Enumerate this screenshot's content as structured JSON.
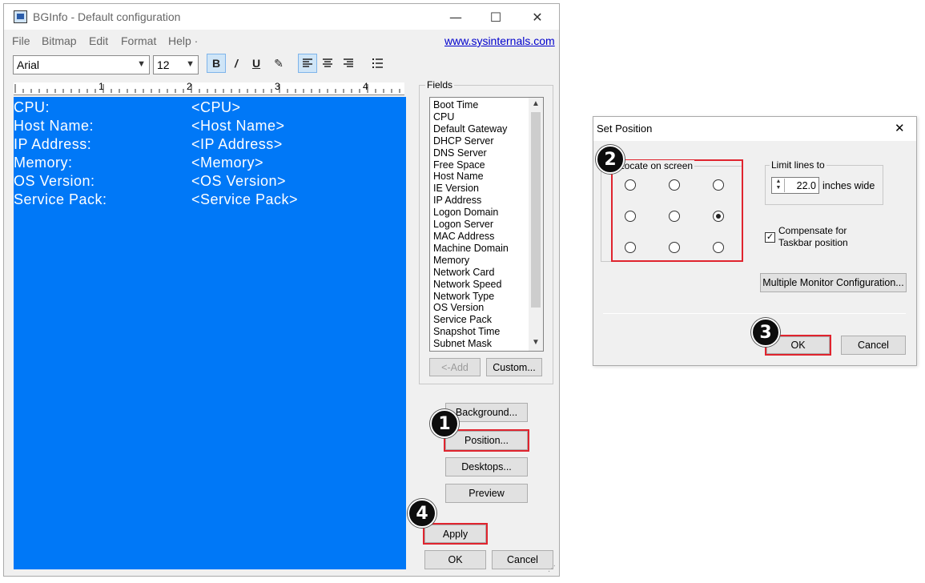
{
  "main_window": {
    "title": "BGInfo - Default configuration",
    "controls": {
      "minimize": "—",
      "maximize": "☐",
      "close": "✕"
    },
    "menu": [
      "File",
      "Bitmap",
      "Edit",
      "Format",
      "Help ·"
    ],
    "link": "www.sysinternals.com",
    "toolbar": {
      "font": "Arial",
      "size": "12",
      "bold": "B",
      "italic": "/",
      "underline": "U",
      "paint": "✎"
    },
    "ruler_numbers": [
      "1",
      "2",
      "3",
      "4"
    ],
    "editor_lines": [
      {
        "label": "CPU:",
        "value": "<CPU>"
      },
      {
        "label": "Host Name:",
        "value": "<Host Name>"
      },
      {
        "label": "IP Address:",
        "value": "<IP Address>"
      },
      {
        "label": "Memory:",
        "value": "<Memory>"
      },
      {
        "label": "OS Version:",
        "value": "<OS Version>"
      },
      {
        "label": "Service Pack:",
        "value": "<Service Pack>"
      }
    ],
    "fields": {
      "title": "Fields",
      "items": [
        "Boot Time",
        "CPU",
        "Default Gateway",
        "DHCP Server",
        "DNS Server",
        "Free Space",
        "Host Name",
        "IE Version",
        "IP Address",
        "Logon Domain",
        "Logon Server",
        "MAC Address",
        "Machine Domain",
        "Memory",
        "Network Card",
        "Network Speed",
        "Network Type",
        "OS Version",
        "Service Pack",
        "Snapshot Time",
        "Subnet Mask"
      ],
      "add_label": "<-Add",
      "custom_label": "Custom..."
    },
    "buttons": {
      "background": "Background...",
      "position": "Position...",
      "desktops": "Desktops...",
      "preview": "Preview",
      "apply": "Apply",
      "ok": "OK",
      "cancel": "Cancel"
    }
  },
  "set_position_dialog": {
    "title": "Set Position",
    "close": "✕",
    "locate_label": "Locate on screen",
    "selected_position": "middle-right",
    "limit_lines_label": "Limit lines to",
    "limit_value": "22.0",
    "inches_label": "inches wide",
    "compensate_checked": true,
    "compensate_label_1": "Compensate for",
    "compensate_label_2": "Taskbar position",
    "multi_monitor_label": "Multiple Monitor Configuration...",
    "ok_label": "OK",
    "cancel_label": "Cancel"
  },
  "badges": [
    "1",
    "2",
    "3",
    "4"
  ],
  "colors": {
    "editor_bg": "#0078f7",
    "highlight": "#e0242e"
  }
}
